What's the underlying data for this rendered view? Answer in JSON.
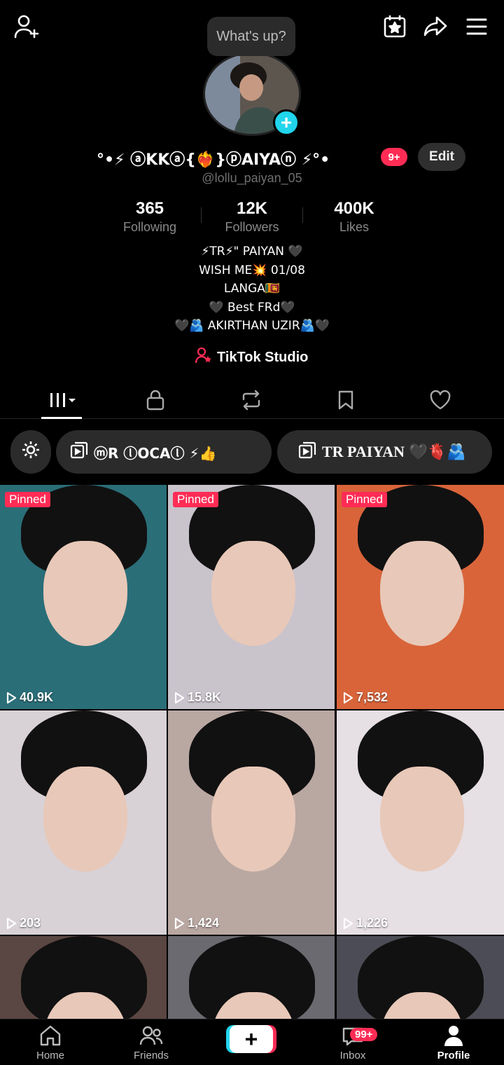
{
  "header": {
    "bubble_text": "What's up?"
  },
  "profile": {
    "display_name": "°•⚡ ⓐKKⓐ{❤️‍🔥}ⓟAIYAⓝ ⚡°•",
    "notif_badge": "9+",
    "edit_label": "Edit",
    "username": "@lollu_paiyan_05"
  },
  "stats": [
    {
      "value": "365",
      "label": "Following"
    },
    {
      "value": "12K",
      "label": "Followers"
    },
    {
      "value": "400K",
      "label": "Likes"
    }
  ],
  "bio": [
    "⚡TR⚡\" PAIYAN 🖤",
    "WISH ME💥 01/08",
    "LANGA🇱🇰",
    "🖤 Best FRd🖤",
    "🖤🫂 AKIRTHAN UZIR🫂🖤"
  ],
  "studio_label": "TikTok Studio",
  "chips": {
    "chip1": "ⓜR ⓛOCAⓛ ⚡👍",
    "chip2": "TR PAIYAN 🖤🫀🫂"
  },
  "videos": [
    {
      "pinned": "Pinned",
      "views": "40.9K",
      "bg": "#2a6e78"
    },
    {
      "pinned": "Pinned",
      "views": "15.8K",
      "bg": "#c9c3cc"
    },
    {
      "pinned": "Pinned",
      "views": "7,532",
      "bg": "#d9643a"
    },
    {
      "pinned": "",
      "views": "203",
      "bg": "#d8d2d6"
    },
    {
      "pinned": "",
      "views": "1,424",
      "bg": "#b9a7a2"
    },
    {
      "pinned": "",
      "views": "1,226",
      "bg": "#e6dfe4"
    },
    {
      "pinned": "",
      "views": "",
      "bg": "#5a4642"
    },
    {
      "pinned": "",
      "views": "",
      "bg": "#6a6a70"
    },
    {
      "pinned": "",
      "views": "",
      "bg": "#4b4c55"
    }
  ],
  "nav": {
    "home": "Home",
    "friends": "Friends",
    "inbox": "Inbox",
    "inbox_badge": "99+",
    "profile": "Profile"
  }
}
